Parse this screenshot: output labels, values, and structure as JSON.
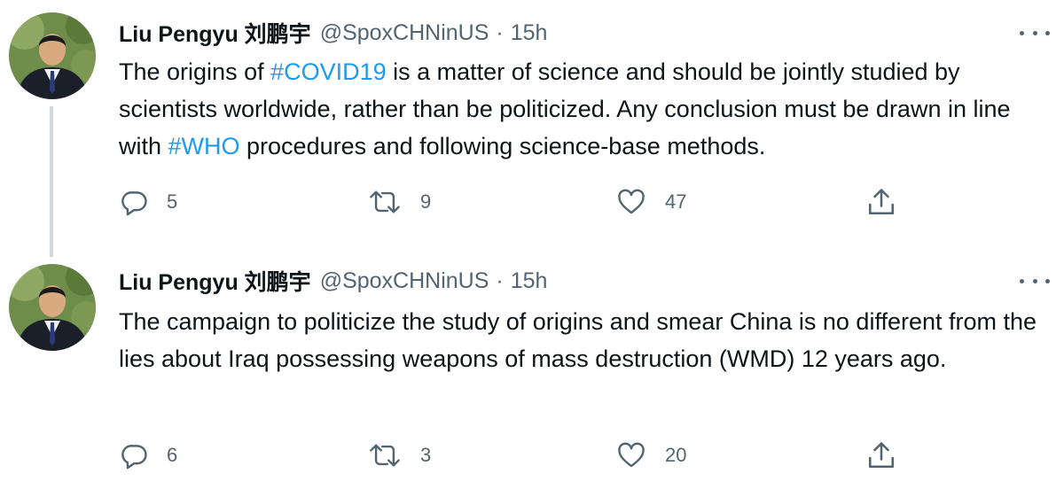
{
  "tweets": [
    {
      "author_name": "Liu Pengyu 刘鹏宇",
      "handle": "@SpoxCHNinUS",
      "separator": "·",
      "time": "15h",
      "text_parts": [
        "The origins of ",
        "#COVID19",
        " is a matter of science and should be jointly studied by scientists worldwide, rather than be politicized. Any conclusion must be drawn in line with ",
        "#WHO",
        " procedures and following science-base methods."
      ],
      "replies": "5",
      "retweets": "9",
      "likes": "47"
    },
    {
      "author_name": "Liu Pengyu 刘鹏宇",
      "handle": "@SpoxCHNinUS",
      "separator": "·",
      "time": "15h",
      "text": "The campaign to politicize the study of origins and smear China is no different from the lies about Iraq possessing weapons of mass destruction (WMD) 12 years ago.",
      "replies": "6",
      "retweets": "3",
      "likes": "20"
    }
  ],
  "colors": {
    "hashtag": "#1d9bf0",
    "secondary_text": "#536471",
    "thread_line": "#cfd9de"
  },
  "icons": [
    "reply-icon",
    "retweet-icon",
    "like-icon",
    "share-icon",
    "more-icon"
  ]
}
